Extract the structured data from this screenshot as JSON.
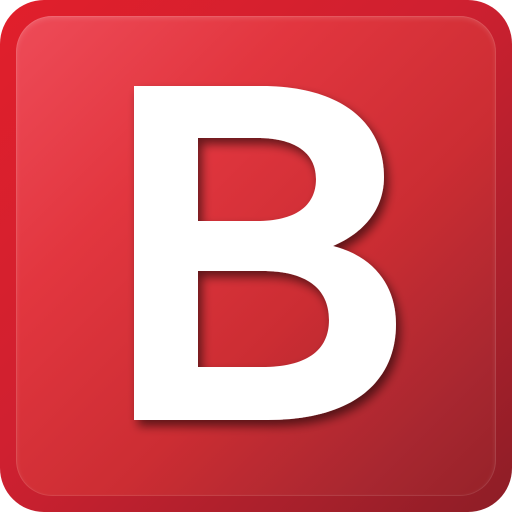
{
  "icon": {
    "letter": "B",
    "colors": {
      "background": "#d12a33",
      "letter": "#ffffff"
    }
  }
}
